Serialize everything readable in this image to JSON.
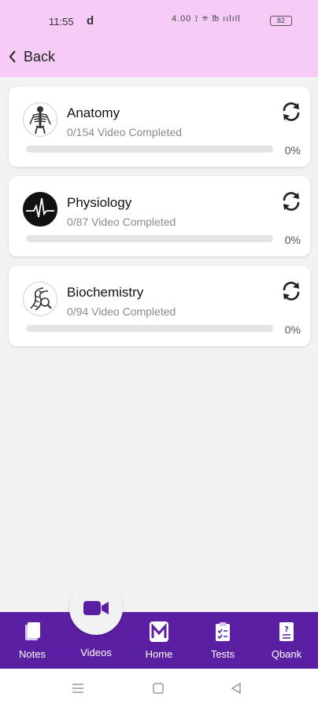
{
  "status_bar": {
    "time": "11:55",
    "carrier_glyph": "d",
    "icons_text": "4.00  ⟟ ☏ ℔ ıılıll",
    "battery": "82"
  },
  "header": {
    "back_label": "Back"
  },
  "subjects": [
    {
      "title": "Anatomy",
      "subtitle": "0/154 Video Completed",
      "percent": "0%",
      "progress": 0,
      "icon": "skeleton-icon"
    },
    {
      "title": "Physiology",
      "subtitle": "0/87 Video Completed",
      "percent": "0%",
      "progress": 0,
      "icon": "heartbeat-icon"
    },
    {
      "title": "Biochemistry",
      "subtitle": "0/94 Video Completed",
      "percent": "0%",
      "progress": 0,
      "icon": "dna-icon"
    }
  ],
  "bottom_nav": {
    "notes": "Notes",
    "videos": "Videos",
    "home": "Home",
    "tests": "Tests",
    "qbank": "Qbank"
  },
  "colors": {
    "header_bg": "#f6ccf6",
    "nav_bg": "#5b1fa3",
    "accent": "#5b1fa3"
  }
}
